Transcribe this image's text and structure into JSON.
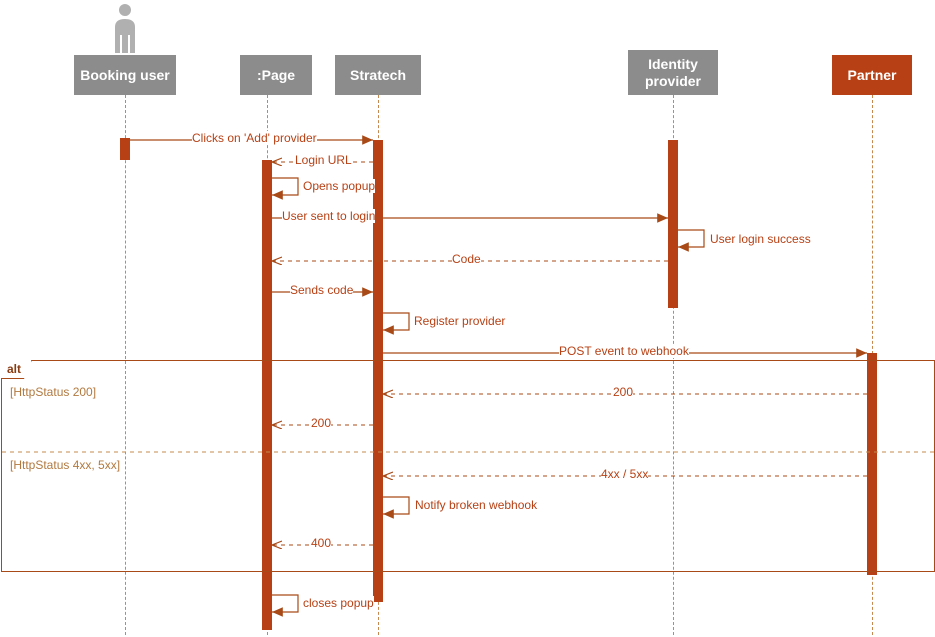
{
  "actors": {
    "booking_user": "Booking user",
    "page": ":Page",
    "stratech": "Stratech",
    "identity_provider": "Identity provider",
    "partner": "Partner"
  },
  "messages": {
    "m1": "Clicks on 'Add' provider",
    "m2": "Login URL",
    "m3": "Opens popup",
    "m4": "User sent to login",
    "m5": "User login success",
    "m6": "Code",
    "m7": "Sends code",
    "m8": "Register provider",
    "m9": "POST event to webhook",
    "m10": "200",
    "m11": "200",
    "m12": "4xx / 5xx",
    "m13": "Notify broken webhook",
    "m14": "400",
    "m15": "closes popup"
  },
  "fragment": {
    "operator": "alt",
    "guard1": "[HttpStatus 200]",
    "guard2": "[HttpStatus 4xx, 5xx]"
  },
  "chart_data": {
    "type": "uml-sequence",
    "participants": [
      "Booking user",
      ":Page",
      "Stratech",
      "Identity provider",
      "Partner"
    ],
    "interactions": [
      {
        "from": "Booking user",
        "to": "Stratech",
        "label": "Clicks on 'Add' provider",
        "kind": "sync"
      },
      {
        "from": "Stratech",
        "to": ":Page",
        "label": "Login URL",
        "kind": "return"
      },
      {
        "from": ":Page",
        "to": ":Page",
        "label": "Opens popup",
        "kind": "self"
      },
      {
        "from": ":Page",
        "to": "Identity provider",
        "label": "User sent to login",
        "kind": "sync"
      },
      {
        "from": "Identity provider",
        "to": "Identity provider",
        "label": "User login success",
        "kind": "self"
      },
      {
        "from": "Identity provider",
        "to": ":Page",
        "label": "Code",
        "kind": "return"
      },
      {
        "from": ":Page",
        "to": "Stratech",
        "label": "Sends code",
        "kind": "sync"
      },
      {
        "from": "Stratech",
        "to": "Stratech",
        "label": "Register provider",
        "kind": "self"
      },
      {
        "from": "Stratech",
        "to": "Partner",
        "label": "POST event to webhook",
        "kind": "sync"
      },
      {
        "fragment": "alt",
        "guards": [
          "HttpStatus 200",
          "HttpStatus 4xx, 5xx"
        ],
        "branches": [
          [
            {
              "from": "Partner",
              "to": "Stratech",
              "label": "200",
              "kind": "return"
            },
            {
              "from": "Stratech",
              "to": ":Page",
              "label": "200",
              "kind": "return"
            }
          ],
          [
            {
              "from": "Partner",
              "to": "Stratech",
              "label": "4xx / 5xx",
              "kind": "return"
            },
            {
              "from": "Stratech",
              "to": "Stratech",
              "label": "Notify broken webhook",
              "kind": "self"
            },
            {
              "from": "Stratech",
              "to": ":Page",
              "label": "400",
              "kind": "return"
            }
          ]
        ]
      },
      {
        "from": ":Page",
        "to": ":Page",
        "label": "closes popup",
        "kind": "self"
      }
    ]
  }
}
